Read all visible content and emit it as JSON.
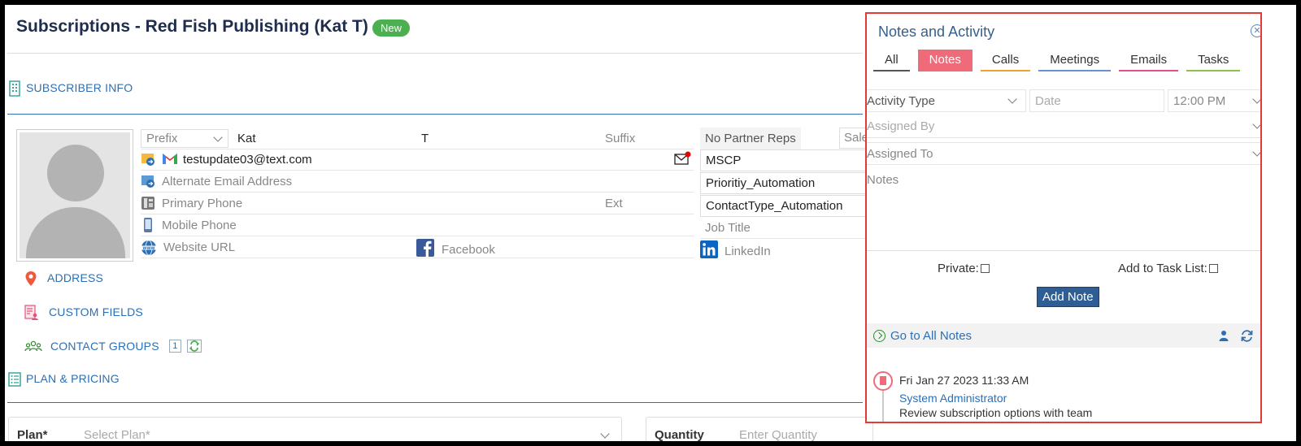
{
  "header": {
    "title": "Subscriptions - Red Fish Publishing (Kat T)",
    "badge": "New"
  },
  "sections": {
    "subscriber_info": "SUBSCRIBER INFO",
    "address": "ADDRESS",
    "custom_fields": "CUSTOM FIELDS",
    "contact_groups": "CONTACT GROUPS",
    "contact_groups_count": "1",
    "plan_pricing": "PLAN & PRICING"
  },
  "contact": {
    "prefix_placeholder": "Prefix",
    "first_name": "Kat",
    "last_name": "T",
    "suffix_placeholder": "Suffix",
    "email": "testupdate03@text.com",
    "alt_email_placeholder": "Alternate Email Address",
    "primary_phone_placeholder": "Primary Phone",
    "ext_placeholder": "Ext",
    "mobile_placeholder": "Mobile Phone",
    "website_placeholder": "Website URL",
    "facebook_placeholder": "Facebook",
    "linkedin_placeholder": "LinkedIn"
  },
  "right_fields": {
    "partner_reps": "No Partner Reps",
    "sales_partial": "Sale",
    "field1": "MSCP",
    "field2": "Prioritiy_Automation",
    "field3": "ContactType_Automation",
    "job_title_placeholder": "Job Title"
  },
  "plan": {
    "plan_label": "Plan*",
    "plan_placeholder": "Select Plan*",
    "quantity_label": "Quantity",
    "quantity_placeholder": "Enter Quantity"
  },
  "notes_panel": {
    "title": "Notes and Activity",
    "tabs": [
      {
        "label": "All",
        "color": "#555555"
      },
      {
        "label": "Notes",
        "color": "#ef6b7a"
      },
      {
        "label": "Calls",
        "color": "#f0a030"
      },
      {
        "label": "Meetings",
        "color": "#6c8fd8"
      },
      {
        "label": "Emails",
        "color": "#e0508c"
      },
      {
        "label": "Tasks",
        "color": "#8cc04a"
      }
    ],
    "activity_type_placeholder": "Activity Type",
    "date_placeholder": "Date",
    "time_value": "12:00 PM",
    "assigned_by_placeholder": "Assigned By",
    "assigned_to_placeholder": "Assigned To",
    "notes_placeholder": "Notes",
    "private_label": "Private:",
    "task_list_label": "Add to Task List:",
    "add_note_label": "Add Note",
    "go_all_notes": "Go to All Notes",
    "entry": {
      "date": "Fri Jan 27 2023 11:33 AM",
      "author": "System Administrator",
      "text": "Review subscription options with team"
    }
  }
}
